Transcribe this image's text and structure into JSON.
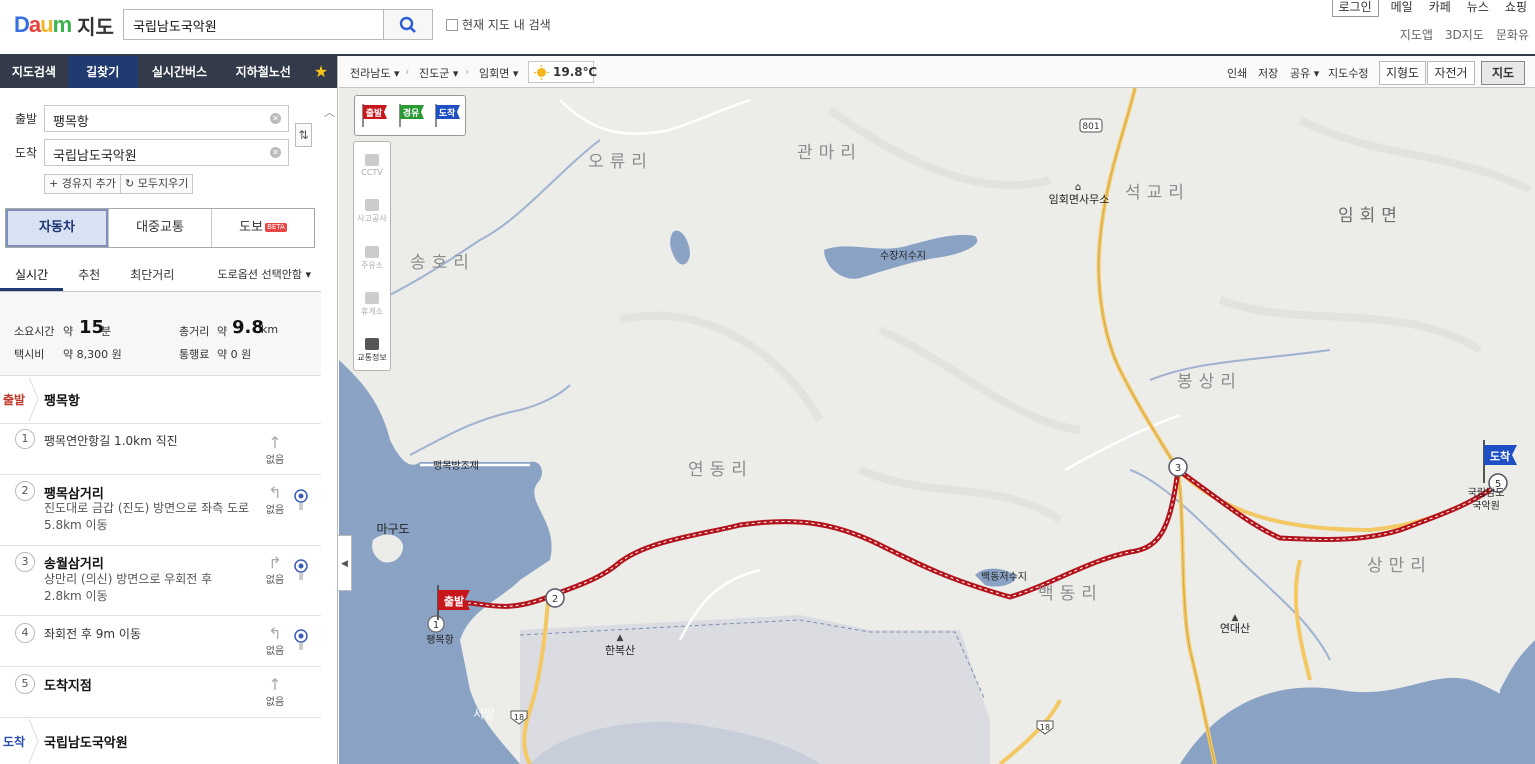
{
  "header": {
    "logo_daum": "Daum",
    "logo_map": "지도",
    "search_value": "국립남도국악원",
    "search_here_label": "현재 지도 내 검색",
    "top_links": [
      "로그인",
      "메일",
      "카페",
      "뉴스",
      "쇼핑"
    ],
    "sub_links": [
      "지도앱",
      "3D지도",
      "문화유"
    ]
  },
  "left_tabs": [
    "지도검색",
    "길찾기",
    "실시간버스",
    "지하철노선"
  ],
  "active_tab": "길찾기",
  "route": {
    "start_label": "출발",
    "start_value": "팽목항",
    "end_label": "도착",
    "end_value": "국립남도국악원",
    "add_waypoint": "경유지 추가",
    "clear_all": "모두지우기"
  },
  "modes": [
    "자동차",
    "대중교통",
    "도보"
  ],
  "active_mode": "자동차",
  "beta_label": "BETA",
  "sub_tabs": [
    "실시간",
    "추천",
    "최단거리"
  ],
  "active_sub_tab": "실시간",
  "road_option": "도로옵션 선택안함",
  "summary": {
    "time_label": "소요시간",
    "approx": "약",
    "time_value": "15",
    "time_unit": "분",
    "dist_label": "총거리",
    "dist_value": "9.8",
    "dist_unit": "km",
    "taxi_label": "택시비",
    "taxi_value": "약 8,300 원",
    "toll_label": "통행료",
    "toll_value": "약 0 원"
  },
  "start_row": {
    "tag": "출발",
    "name": "팽목항"
  },
  "steps": [
    {
      "num": "1",
      "title": "팽목연안항길 1.0km 직진",
      "desc": "",
      "turn": "없음"
    },
    {
      "num": "2",
      "title": "팽목삼거리",
      "desc": "진도대로 금갑 (진도) 방면으로 좌측 도로 5.8km 이동",
      "turn": "없음"
    },
    {
      "num": "3",
      "title": "송월삼거리",
      "desc": "상만리 (의신) 방면으로 우회전 후 2.8km 이동",
      "turn": "없음"
    },
    {
      "num": "4",
      "title": "좌회전 후 9m 이동",
      "desc": "",
      "turn": "없음"
    },
    {
      "num": "5",
      "title": "도착지점",
      "desc": "",
      "turn": "없음"
    }
  ],
  "end_row": {
    "tag": "도착",
    "name": "국립남도국악원"
  },
  "map_toolbar": {
    "breadcrumbs": [
      "전라남도",
      "진도군",
      "임회면"
    ],
    "temperature": "19.8℃",
    "tools": [
      "인쇄",
      "저장",
      "공유",
      "지도수정"
    ],
    "map_types": [
      "지형도",
      "자전거",
      "지도"
    ],
    "active_map_type": "지도"
  },
  "flag_buttons": [
    "출발",
    "경유",
    "도착"
  ],
  "side_tools": [
    "CCTV",
    "사고공사",
    "주유소",
    "휴게소",
    "교통정보"
  ],
  "map_labels": {
    "villages": [
      "오류리",
      "관마리",
      "석교리",
      "임회면",
      "송호리",
      "봉상리",
      "연동리",
      "백동리",
      "상만리"
    ],
    "office": "임회면사무소",
    "reservoir1": "수장저수지",
    "reservoir2": "백동저수지",
    "seawall": "팽목방조제",
    "island": "마구도",
    "mountain1": "한복산",
    "mountain2": "연대산",
    "place_start": "팽목항",
    "place_end": "국립남도\n국악원",
    "place_seomang": "서망",
    "route_801": "801",
    "route_18": "18",
    "marker_start": "출발",
    "marker_end": "도착",
    "pt1": "1",
    "pt2": "2",
    "pt3": "3",
    "pt5": "5"
  },
  "colors": {
    "route": "#b3141c",
    "water": "#8aa3c5",
    "land": "#ecece9",
    "road_major": "#f4c862",
    "nav_dark": "#333a4a",
    "nav_active": "#213a6f"
  }
}
